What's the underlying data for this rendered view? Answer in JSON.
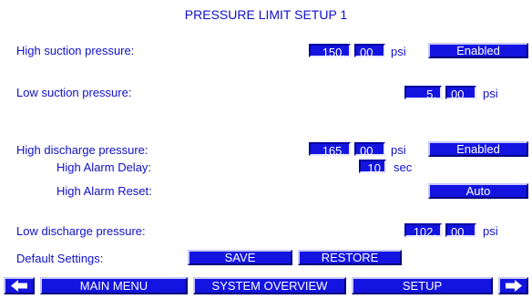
{
  "title": "PRESSURE LIMIT SETUP 1",
  "high_suction": {
    "label": "High suction pressure:",
    "int": "150.",
    "dec": "00",
    "unit": "psi",
    "status": "Enabled"
  },
  "low_suction": {
    "label": "Low suction pressure:",
    "int": "5.",
    "dec": "00",
    "unit": "psi"
  },
  "high_discharge": {
    "label": "High discharge pressure:",
    "int": "165.",
    "dec": "00",
    "unit": "psi",
    "status": "Enabled"
  },
  "high_alarm_delay": {
    "label": "High Alarm Delay:",
    "value": "10",
    "unit": "sec"
  },
  "high_alarm_reset": {
    "label": "High Alarm Reset:",
    "value": "Auto"
  },
  "low_discharge": {
    "label": "Low discharge pressure:",
    "int": "102.",
    "dec": "00",
    "unit": "psi"
  },
  "defaults": {
    "label": "Default Settings:",
    "save": "SAVE",
    "restore": "RESTORE"
  },
  "nav": {
    "main_menu": "MAIN MENU",
    "system_overview": "SYSTEM OVERVIEW",
    "setup": "SETUP",
    "prev_icon": "arrow-left-icon",
    "next_icon": "arrow-right-icon"
  },
  "colors": {
    "field_bg": "#1414e0",
    "text": "#1010c8",
    "background": "#ffffff"
  }
}
